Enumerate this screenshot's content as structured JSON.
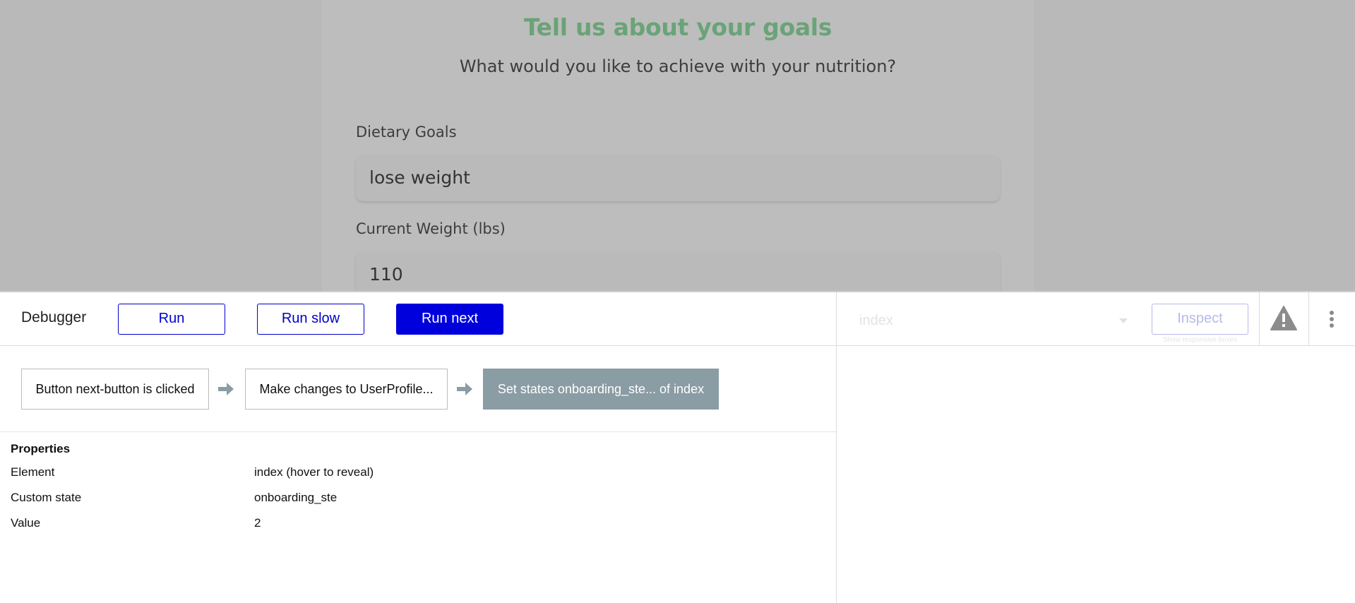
{
  "app_preview": {
    "title": "Tell us about your goals",
    "subtitle": "What would you like to achieve with your nutrition?",
    "fields": [
      {
        "label": "Dietary Goals",
        "value": "lose weight"
      },
      {
        "label": "Current Weight (lbs)",
        "value": "110"
      }
    ],
    "colors": {
      "title": "#6aa377",
      "overlay": "#b9b9b9"
    }
  },
  "debugger": {
    "title": "Debugger",
    "buttons": {
      "run": "Run",
      "run_slow": "Run slow",
      "run_next": "Run next",
      "inspect": "Inspect"
    },
    "element_select": {
      "value": "index"
    },
    "inspect_hint": "Show responsive boxes",
    "steps": [
      {
        "label": "Button next-button is clicked",
        "active": false
      },
      {
        "label": "Make changes to UserProfile...",
        "active": false
      },
      {
        "label": "Set states onboarding_ste... of index",
        "active": true
      }
    ],
    "properties": {
      "heading": "Properties",
      "rows": [
        {
          "key": "Element",
          "value": "index (hover to reveal)"
        },
        {
          "key": "Custom state",
          "value": "onboarding_ste"
        },
        {
          "key": "Value",
          "value": "2"
        }
      ]
    },
    "colors": {
      "primary": "#0000dd",
      "active_step": "#8a9ca4"
    },
    "icons": [
      "warning-icon",
      "more-vertical-icon",
      "arrow-right-icon",
      "chevron-down-icon"
    ]
  }
}
